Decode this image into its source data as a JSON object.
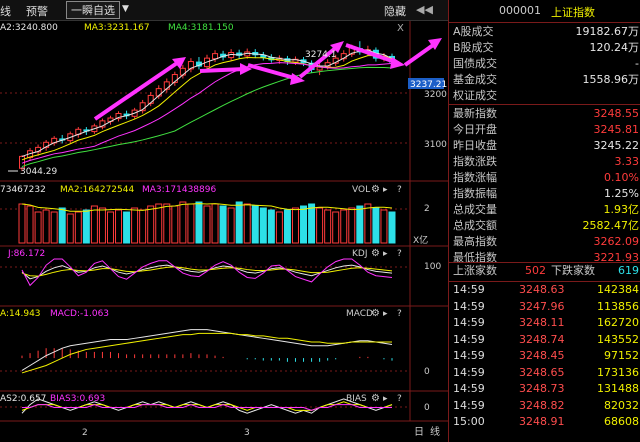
{
  "toolbar": {
    "tab_left": "线",
    "warning": "预警",
    "period": "一瞬自选",
    "hide": "隐藏",
    "hide_arrows": "◀◀"
  },
  "main_legend": {
    "ma2": "A2:3240.800",
    "ma3": "MA3:3231.167",
    "ma4": "MA4:3181.150"
  },
  "price_labels": {
    "high": "3274.1",
    "low": "3044.29",
    "current": "3237.21",
    "axis_3200": "3200",
    "axis_3100": "3100"
  },
  "vol_legend": {
    "v1": "73467232",
    "ma2": "MA2:164272544",
    "ma3": "MA3:171438896",
    "name": "VOL",
    "axis_2": "2",
    "unit": "X亿"
  },
  "kdj_legend": {
    "j": "J:86.172",
    "name": "KDJ",
    "axis_100": "100"
  },
  "macd_legend": {
    "dea": "A:14.943",
    "macd": "MACD:-1.063",
    "name": "MACD",
    "axis_0": "0"
  },
  "bias_legend": {
    "bias2": "AS2:0.657",
    "bias3": "BIAS3:0.693",
    "name": "BIAS",
    "axis_0": "0"
  },
  "panel_icons": {
    "gear": "⚙",
    "right": "▸",
    "help": "?",
    "close": "X"
  },
  "x_axis": {
    "m2": "2",
    "m3": "3",
    "day": "日",
    "line": "线"
  },
  "chart_data": {
    "type": "candlestick",
    "price_ylim": [
      3030,
      3285
    ],
    "ticks": [
      3200,
      3100
    ],
    "candles": [
      [
        3049,
        3070,
        3044,
        3072
      ],
      [
        3068,
        3080,
        3062,
        3085
      ],
      [
        3078,
        3086,
        3071,
        3091
      ],
      [
        3086,
        3095,
        3080,
        3099
      ],
      [
        3094,
        3102,
        3089,
        3106
      ],
      [
        3101,
        3099,
        3093,
        3108
      ],
      [
        3098,
        3110,
        3094,
        3114
      ],
      [
        3109,
        3118,
        3103,
        3122
      ],
      [
        3117,
        3115,
        3108,
        3122
      ],
      [
        3114,
        3124,
        3110,
        3128
      ],
      [
        3122,
        3133,
        3118,
        3137
      ],
      [
        3132,
        3138,
        3126,
        3142
      ],
      [
        3137,
        3146,
        3132,
        3150
      ],
      [
        3145,
        3142,
        3136,
        3151
      ],
      [
        3141,
        3152,
        3137,
        3156
      ],
      [
        3151,
        3165,
        3146,
        3170
      ],
      [
        3164,
        3178,
        3159,
        3184
      ],
      [
        3177,
        3190,
        3172,
        3196
      ],
      [
        3189,
        3202,
        3183,
        3208
      ],
      [
        3201,
        3215,
        3195,
        3220
      ],
      [
        3214,
        3226,
        3208,
        3232
      ],
      [
        3225,
        3238,
        3219,
        3244
      ],
      [
        3237,
        3230,
        3224,
        3246
      ],
      [
        3229,
        3244,
        3224,
        3250
      ],
      [
        3243,
        3252,
        3237,
        3258
      ],
      [
        3251,
        3246,
        3240,
        3257
      ],
      [
        3245,
        3254,
        3240,
        3260
      ],
      [
        3253,
        3249,
        3243,
        3259
      ],
      [
        3248,
        3255,
        3243,
        3261
      ],
      [
        3254,
        3250,
        3244,
        3260
      ],
      [
        3249,
        3246,
        3240,
        3255
      ],
      [
        3245,
        3241,
        3236,
        3251
      ],
      [
        3240,
        3244,
        3234,
        3249
      ],
      [
        3243,
        3238,
        3232,
        3248
      ],
      [
        3237,
        3242,
        3232,
        3247
      ],
      [
        3241,
        3236,
        3230,
        3246
      ],
      [
        3235,
        3224,
        3218,
        3240
      ],
      [
        3223,
        3230,
        3214,
        3236
      ],
      [
        3229,
        3236,
        3224,
        3242
      ],
      [
        3235,
        3244,
        3230,
        3250
      ],
      [
        3243,
        3252,
        3238,
        3258
      ],
      [
        3251,
        3262,
        3246,
        3268
      ],
      [
        3261,
        3255,
        3250,
        3274
      ],
      [
        3254,
        3259,
        3248,
        3266
      ],
      [
        3258,
        3244,
        3238,
        3263
      ],
      [
        3243,
        3248,
        3238,
        3253
      ],
      [
        3247,
        3237,
        3232,
        3252
      ]
    ],
    "volume_ylim": [
      0,
      2.3
    ],
    "volume": [
      1.95,
      1.85,
      1.55,
      1.65,
      1.55,
      1.75,
      1.45,
      1.55,
      1.65,
      1.85,
      1.75,
      1.55,
      1.65,
      1.55,
      1.75,
      1.65,
      1.85,
      1.95,
      1.95,
      1.85,
      2.05,
      1.95,
      2.05,
      1.85,
      1.95,
      1.85,
      1.75,
      2.05,
      1.95,
      1.85,
      1.75,
      1.65,
      1.55,
      1.65,
      1.75,
      1.85,
      1.95,
      1.75,
      1.65,
      1.55,
      1.65,
      1.75,
      1.85,
      1.95,
      1.75,
      1.65,
      1.55
    ],
    "kdj": {
      "ylim": [
        0,
        100
      ],
      "k": [
        70,
        55,
        60,
        72,
        80,
        85,
        78,
        70,
        72,
        80,
        84,
        78,
        70,
        66,
        70,
        76,
        80,
        84,
        86,
        82,
        76,
        72,
        70,
        74,
        80,
        84,
        82,
        76,
        70,
        68,
        72,
        78,
        80,
        76,
        70,
        66,
        62,
        68,
        74,
        80,
        84,
        86,
        82,
        76,
        72,
        70,
        68
      ],
      "d": [
        68,
        62,
        61,
        65,
        70,
        74,
        76,
        74,
        73,
        75,
        78,
        78,
        75,
        72,
        71,
        73,
        75,
        78,
        81,
        82,
        80,
        77,
        75,
        75,
        77,
        79,
        80,
        79,
        76,
        74,
        74,
        75,
        77,
        77,
        75,
        72,
        69,
        69,
        70,
        73,
        76,
        79,
        80,
        79,
        77,
        75,
        73
      ],
      "j": [
        75,
        40,
        58,
        86,
        100,
        100,
        82,
        62,
        70,
        90,
        96,
        78,
        60,
        54,
        68,
        82,
        90,
        96,
        96,
        82,
        68,
        62,
        60,
        72,
        86,
        94,
        86,
        70,
        58,
        56,
        68,
        84,
        86,
        74,
        60,
        54,
        48,
        66,
        82,
        94,
        100,
        100,
        86,
        70,
        62,
        60,
        58
      ]
    },
    "macd": {
      "ylim": [
        -25,
        30
      ],
      "dif": [
        -10,
        -6,
        -2,
        2,
        5,
        8,
        10,
        11,
        12,
        13,
        14,
        15,
        15,
        15,
        16,
        17,
        18,
        19,
        20,
        21,
        22,
        23,
        23,
        23,
        22,
        21,
        20,
        19,
        18,
        17,
        16,
        15,
        14,
        13,
        12,
        11,
        10,
        10,
        10,
        11,
        12,
        13,
        14,
        14,
        13,
        12,
        11
      ],
      "dea": [
        -12,
        -10,
        -8,
        -6,
        -3,
        0,
        3,
        5,
        7,
        8,
        9,
        10,
        11,
        12,
        13,
        14,
        15,
        16,
        17,
        18,
        19,
        19,
        20,
        20,
        20,
        20,
        20,
        19,
        19,
        18,
        18,
        17,
        16,
        16,
        15,
        14,
        13,
        13,
        12,
        12,
        12,
        13,
        13,
        13,
        13,
        13,
        13
      ],
      "hist": [
        2,
        4,
        6,
        8,
        8,
        8,
        7,
        6,
        5,
        5,
        5,
        5,
        4,
        3,
        3,
        3,
        3,
        3,
        3,
        3,
        3,
        4,
        3,
        3,
        2,
        1,
        0,
        0,
        -1,
        -1,
        -2,
        -2,
        -2,
        -3,
        -3,
        -3,
        -3,
        -3,
        -2,
        -1,
        0,
        0,
        1,
        1,
        0,
        -1,
        -2
      ]
    },
    "bias": {
      "ylim": [
        -4,
        4
      ],
      "b1": [
        -2,
        1,
        3,
        2,
        1,
        0,
        -1,
        0,
        1,
        2,
        1,
        0,
        -1,
        0,
        1,
        2,
        1,
        2,
        1,
        0,
        1,
        2,
        1,
        0,
        1,
        2,
        1,
        -1,
        -2,
        -1,
        0,
        1,
        0,
        -1,
        -2,
        -1,
        -2,
        0,
        1,
        2,
        3,
        2,
        1,
        0,
        -1,
        0,
        1
      ],
      "b2": [
        -1,
        0,
        1,
        1,
        1,
        0,
        0,
        0,
        1,
        1,
        1,
        0,
        0,
        0,
        1,
        1,
        1,
        1,
        1,
        0,
        1,
        1,
        1,
        0,
        1,
        1,
        1,
        0,
        -1,
        0,
        0,
        0,
        0,
        0,
        -1,
        -1,
        -1,
        0,
        1,
        1,
        2,
        1,
        1,
        0,
        0,
        0,
        1
      ],
      "b3": [
        0,
        0,
        1,
        1,
        0,
        0,
        0,
        0,
        0,
        1,
        0,
        0,
        0,
        0,
        0,
        1,
        1,
        1,
        0,
        0,
        0,
        1,
        0,
        0,
        0,
        1,
        0,
        0,
        0,
        0,
        0,
        0,
        0,
        0,
        0,
        0,
        -1,
        0,
        0,
        1,
        1,
        1,
        0,
        0,
        0,
        0,
        0
      ]
    }
  },
  "right_panel": {
    "code": "000001",
    "name": "上证指数",
    "rows1": [
      {
        "label": "A股成交",
        "value": "19182.67万",
        "color": "#e6e6e6"
      },
      {
        "label": "B股成交",
        "value": "120.24万",
        "color": "#e6e6e6"
      },
      {
        "label": "国债成交",
        "value": "-",
        "color": "#e6e6e6"
      },
      {
        "label": "基金成交",
        "value": "1558.96万",
        "color": "#e6e6e6"
      },
      {
        "label": "权证成交",
        "value": "",
        "color": "#e6e6e6"
      }
    ],
    "rows2": [
      {
        "label": "最新指数",
        "value": "3248.55",
        "color": "#ff3b3b"
      },
      {
        "label": "今日开盘",
        "value": "3245.81",
        "color": "#ff3b3b"
      },
      {
        "label": "昨日收盘",
        "value": "3245.22",
        "color": "#e6e6e6"
      },
      {
        "label": "指数涨跌",
        "value": "3.33",
        "color": "#ff3b3b"
      },
      {
        "label": "指数涨幅",
        "value": "0.10%",
        "color": "#ff3b3b"
      },
      {
        "label": "指数振幅",
        "value": "1.25%",
        "color": "#e6e6e6"
      },
      {
        "label": "总成交量",
        "value": "1.93亿",
        "color": "#f0f000"
      },
      {
        "label": "总成交额",
        "value": "2582.47亿",
        "color": "#f0f000"
      },
      {
        "label": "最高指数",
        "value": "3262.09",
        "color": "#ff3b3b"
      },
      {
        "label": "最低指数",
        "value": "3221.93",
        "color": "#ff3b3b"
      }
    ],
    "updown": {
      "up_label": "上涨家数",
      "up_value": "502",
      "down_label": "下跌家数",
      "down_value": "619"
    },
    "ticks": [
      {
        "t": "14:59",
        "p": "3248.63",
        "v": "142384"
      },
      {
        "t": "14:59",
        "p": "3247.96",
        "v": "113856"
      },
      {
        "t": "14:59",
        "p": "3248.11",
        "v": "162720"
      },
      {
        "t": "14:59",
        "p": "3248.74",
        "v": "143552"
      },
      {
        "t": "14:59",
        "p": "3248.45",
        "v": "97152"
      },
      {
        "t": "14:59",
        "p": "3248.65",
        "v": "173136"
      },
      {
        "t": "14:59",
        "p": "3248.73",
        "v": "131488"
      },
      {
        "t": "14:59",
        "p": "3248.82",
        "v": "82032"
      },
      {
        "t": "15:00",
        "p": "3248.91",
        "v": "68608"
      }
    ]
  },
  "colors": {
    "up": "#ff3b3b",
    "down": "#2de0e8",
    "accent": "#ff33ff",
    "panel_border": "#7a1a1a"
  }
}
